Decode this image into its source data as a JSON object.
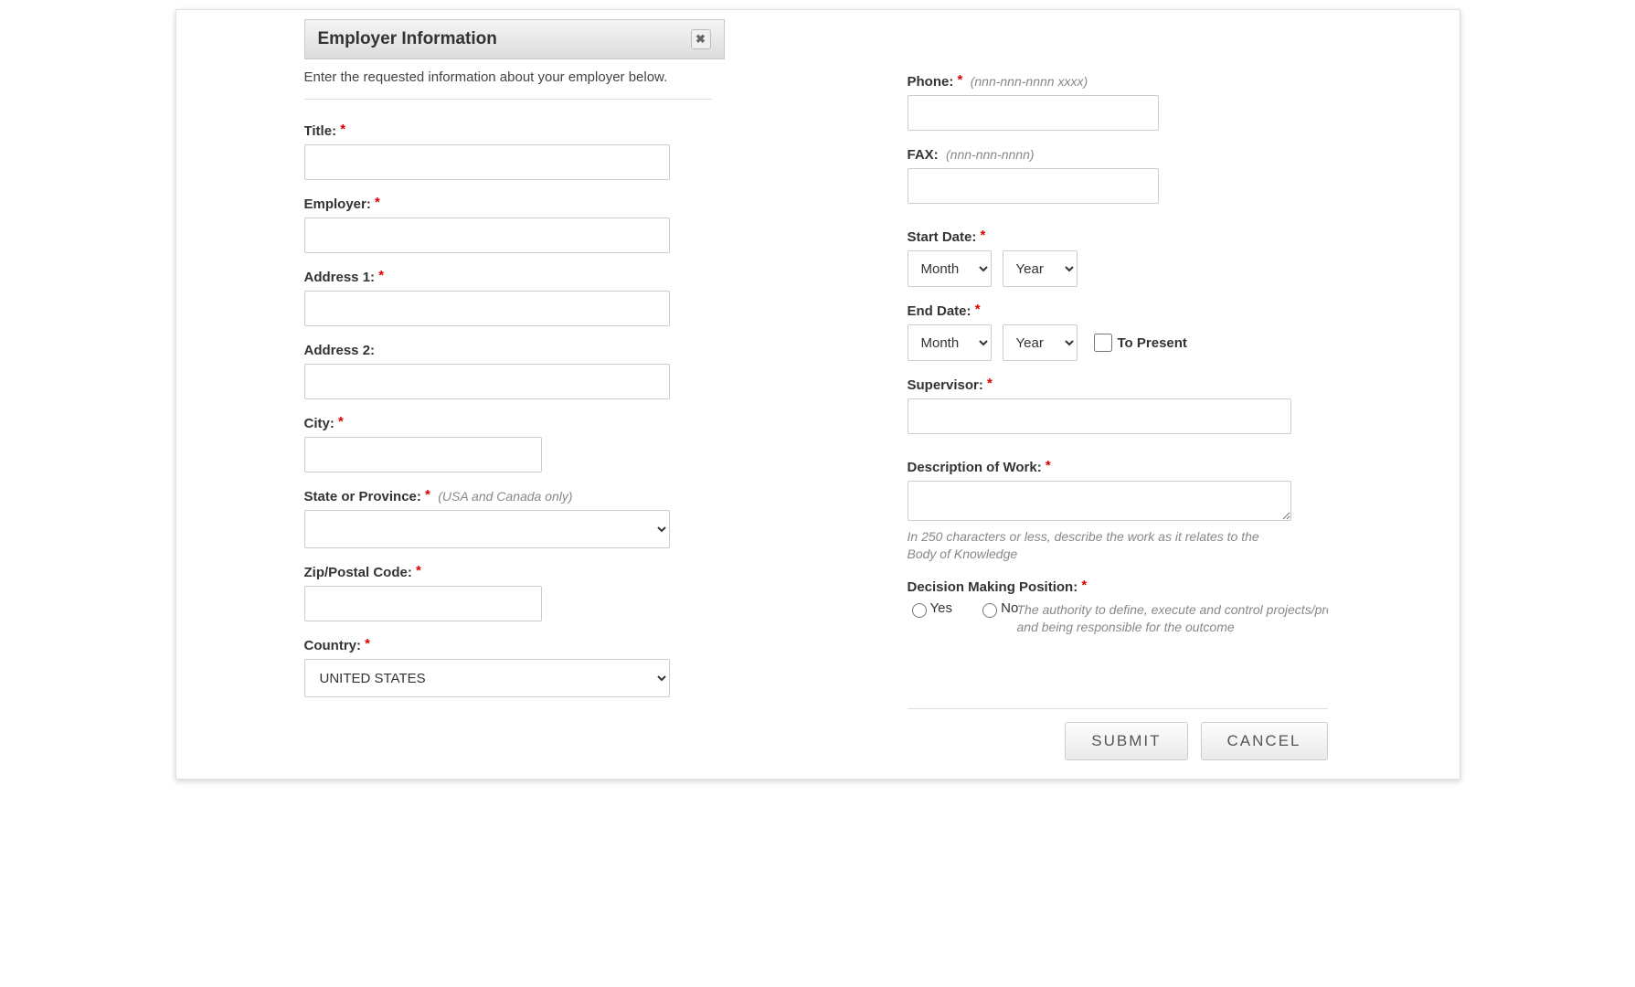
{
  "panel": {
    "title": "Employer Information",
    "intro": "Enter the requested information about your employer below."
  },
  "left": {
    "title_label": "Title:",
    "employer_label": "Employer:",
    "address1_label": "Address 1:",
    "address2_label": "Address 2:",
    "city_label": "City:",
    "state_label": "State or Province:",
    "state_hint": "(USA and Canada only)",
    "zip_label": "Zip/Postal Code:",
    "country_label": "Country:",
    "country_value": "UNITED STATES"
  },
  "right": {
    "phone_label": "Phone:",
    "phone_hint": "(nnn-nnn-nnnn xxxx)",
    "fax_label": "FAX:",
    "fax_hint": "(nnn-nnn-nnnn)",
    "start_label": "Start Date:",
    "end_label": "End Date:",
    "month_option": "Month",
    "year_option": "Year",
    "to_present": "To Present",
    "supervisor_label": "Supervisor:",
    "desc_label": "Description of Work:",
    "desc_helper": "In 250 characters or less, describe the work as it relates to the Body of Knowledge",
    "decision_label": "Decision Making Position:",
    "yes": "Yes",
    "no": "No",
    "decision_helper": "The authority to define, execute and control projects/processes and being responsible for the outcome"
  },
  "buttons": {
    "submit": "SUBMIT",
    "cancel": "CANCEL"
  }
}
